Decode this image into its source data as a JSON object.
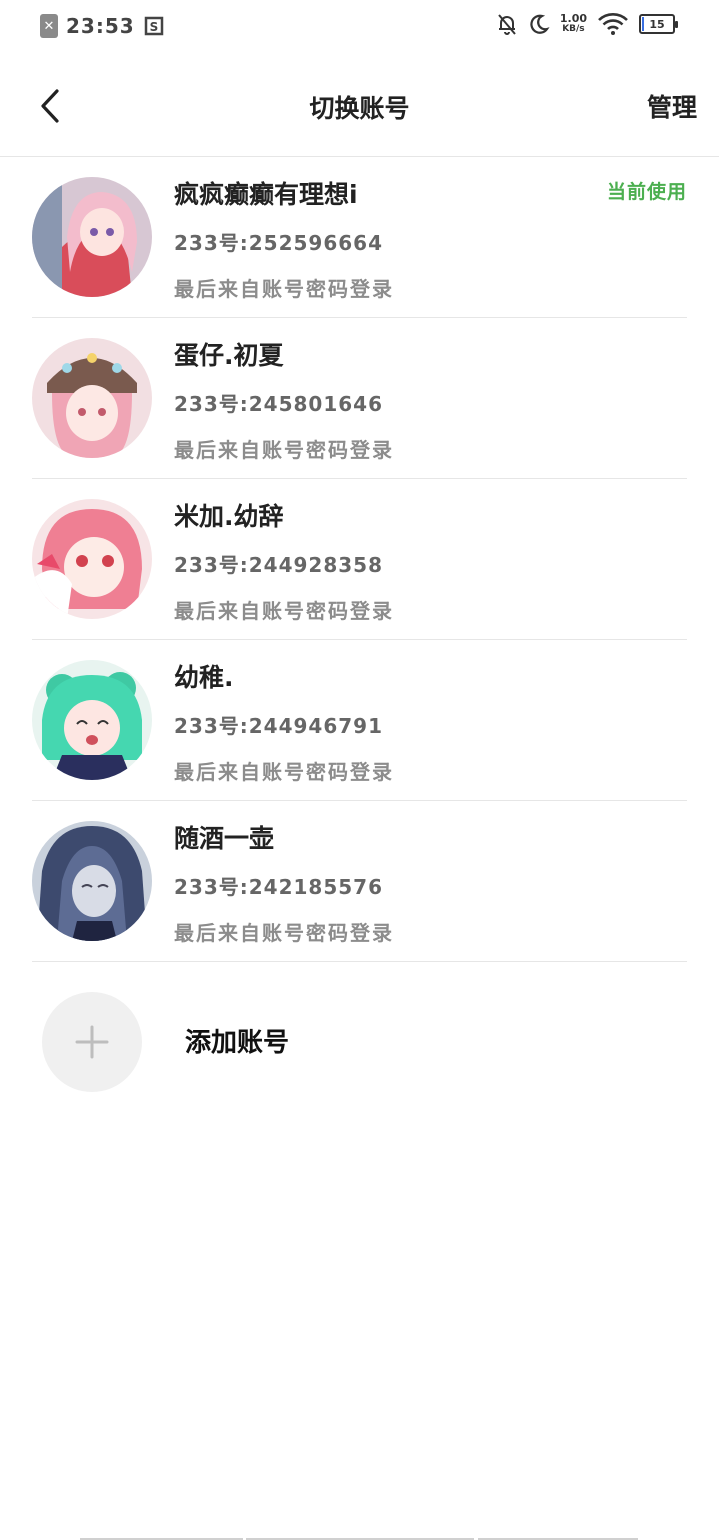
{
  "status_bar": {
    "time": "23:53",
    "net_speed_value": "1.00",
    "net_speed_unit": "KB/s",
    "battery": "15"
  },
  "nav": {
    "title": "切换账号",
    "manage_label": "管理"
  },
  "accounts": [
    {
      "name": "疯疯癫癫有理想i",
      "id": "233号:252596664",
      "login": "最后来自账号密码登录",
      "status": "当前使用"
    },
    {
      "name": "蛋仔.初夏",
      "id": "233号:245801646",
      "login": "最后来自账号密码登录"
    },
    {
      "name": "米加.幼辞",
      "id": "233号:244928358",
      "login": "最后来自账号密码登录"
    },
    {
      "name": "幼稚.",
      "id": "233号:244946791",
      "login": "最后来自账号密码登录"
    },
    {
      "name": "随酒一壶",
      "id": "233号:242185576",
      "login": "最后来自账号密码登录"
    }
  ],
  "add_account": {
    "label": "添加账号"
  },
  "colors": {
    "current_tag": "#4caf50"
  }
}
